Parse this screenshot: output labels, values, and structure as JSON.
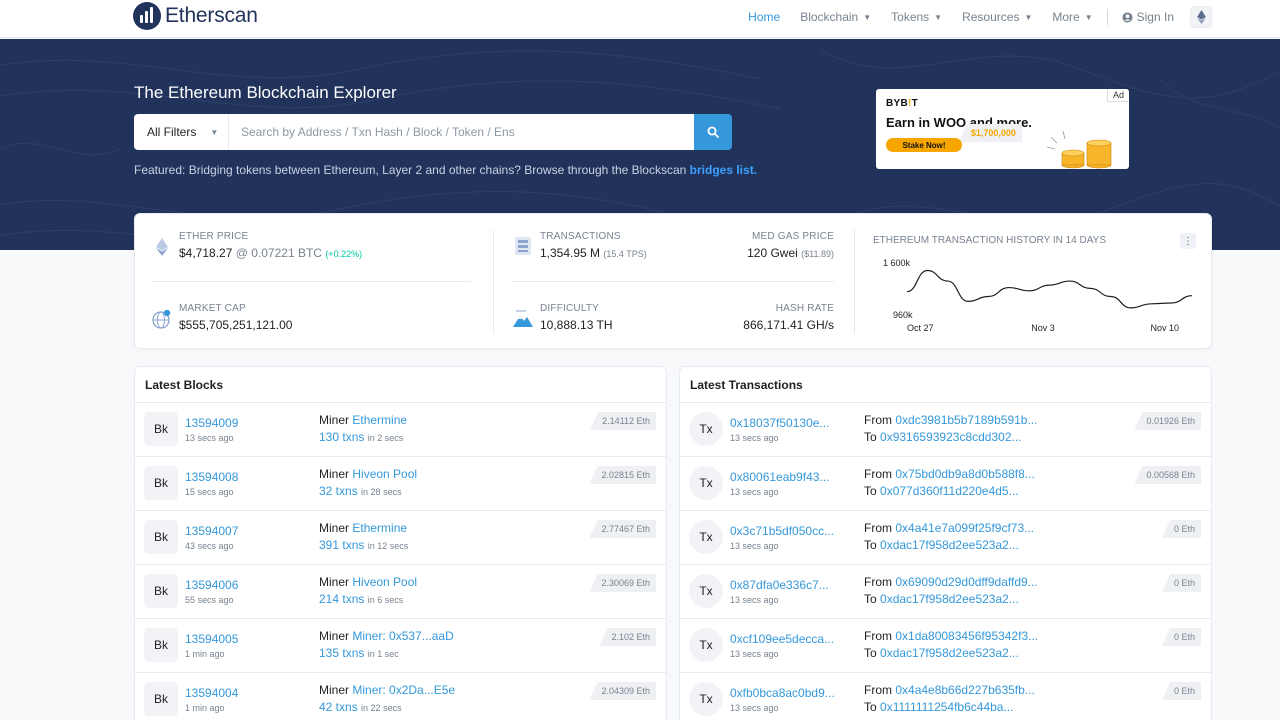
{
  "nav": {
    "logo_text": "Etherscan",
    "links": [
      {
        "label": "Home",
        "dropdown": false,
        "active": true
      },
      {
        "label": "Blockchain",
        "dropdown": true,
        "active": false
      },
      {
        "label": "Tokens",
        "dropdown": true,
        "active": false
      },
      {
        "label": "Resources",
        "dropdown": true,
        "active": false
      },
      {
        "label": "More",
        "dropdown": true,
        "active": false
      }
    ],
    "signin_label": "Sign In"
  },
  "hero": {
    "title": "The Ethereum Blockchain Explorer",
    "filter_label": "All Filters",
    "search_placeholder": "Search by Address / Txn Hash / Block / Token / Ens",
    "featured_text": "Featured: Bridging tokens between Ethereum, Layer 2 and other chains? Browse through the Blockscan ",
    "featured_link": "bridges list."
  },
  "ad": {
    "tag": "Ad",
    "brand_a": "BYB",
    "brand_b": "!",
    "brand_c": "T",
    "headline_a": "Earn ",
    "headline_amt": "$1,700,000",
    "headline_b": " in WOO and more.",
    "cta": "Stake Now!"
  },
  "stats": {
    "ether_price_label": "Ether Price",
    "ether_price_usd": "$4,718.27",
    "ether_price_btc": "@ 0.07221 BTC",
    "ether_price_change": "(+0.22%)",
    "market_cap_label": "Market Cap",
    "market_cap_value": "$555,705,251,121.00",
    "transactions_label": "Transactions",
    "transactions_value": "1,354.95 M",
    "transactions_tps": "(15.4 TPS)",
    "gas_label": "Med Gas Price",
    "gas_value": "120 Gwei",
    "gas_usd": "($11.89)",
    "difficulty_label": "Difficulty",
    "difficulty_value": "10,888.13 TH",
    "hashrate_label": "Hash Rate",
    "hashrate_value": "866,171.41 GH/s"
  },
  "chart_data": {
    "type": "line",
    "title": "Ethereum Transaction History in 14 Days",
    "x_ticks": [
      "Oct 27",
      "Nov 3",
      "Nov 10"
    ],
    "y_ticks": [
      "1 600k",
      "960k"
    ],
    "x": [
      "Oct 27",
      "Oct 28",
      "Oct 29",
      "Oct 30",
      "Oct 31",
      "Nov 1",
      "Nov 2",
      "Nov 3",
      "Nov 4",
      "Nov 5",
      "Nov 6",
      "Nov 7",
      "Nov 8",
      "Nov 9",
      "Nov 10"
    ],
    "values": [
      1260000,
      1520000,
      1390000,
      1140000,
      1200000,
      1310000,
      1270000,
      1340000,
      1390000,
      1300000,
      1200000,
      1060000,
      1110000,
      1120000,
      1210000
    ],
    "ylim": [
      960000,
      1600000
    ]
  },
  "latest_blocks": {
    "title": "Latest Blocks",
    "badge": "Bk",
    "miner_prefix": "Miner",
    "rows": [
      {
        "block": "13594009",
        "age": "13 secs ago",
        "miner": "Ethermine",
        "txns": "130 txns",
        "txn_time": "in 2 secs",
        "reward": "2.14112 Eth"
      },
      {
        "block": "13594008",
        "age": "15 secs ago",
        "miner": "Hiveon Pool",
        "txns": "32 txns",
        "txn_time": "in 28 secs",
        "reward": "2.02815 Eth"
      },
      {
        "block": "13594007",
        "age": "43 secs ago",
        "miner": "Ethermine",
        "txns": "391 txns",
        "txn_time": "in 12 secs",
        "reward": "2.77467 Eth"
      },
      {
        "block": "13594006",
        "age": "55 secs ago",
        "miner": "Hiveon Pool",
        "txns": "214 txns",
        "txn_time": "in 6 secs",
        "reward": "2.30069 Eth"
      },
      {
        "block": "13594005",
        "age": "1 min ago",
        "miner": "Miner: 0x537...aaD",
        "txns": "135 txns",
        "txn_time": "in 1 sec",
        "reward": "2.102 Eth"
      },
      {
        "block": "13594004",
        "age": "1 min ago",
        "miner": "Miner: 0x2Da...E5e",
        "txns": "42 txns",
        "txn_time": "in 22 secs",
        "reward": "2.04309 Eth"
      }
    ]
  },
  "latest_transactions": {
    "title": "Latest Transactions",
    "badge": "Tx",
    "from_prefix": "From",
    "to_prefix": "To",
    "rows": [
      {
        "hash": "0x18037f50130e...",
        "age": "13 secs ago",
        "from": "0xdc3981b5b7189b591b...",
        "to": "0x9316593923c8cdd302...",
        "value": "0.01926 Eth"
      },
      {
        "hash": "0x80061eab9f43...",
        "age": "13 secs ago",
        "from": "0x75bd0db9a8d0b588f8...",
        "to": "0x077d360f11d220e4d5...",
        "value": "0.00568 Eth"
      },
      {
        "hash": "0x3c71b5df050cc...",
        "age": "13 secs ago",
        "from": "0x4a41e7a099f25f9cf73...",
        "to": "0xdac17f958d2ee523a2...",
        "value": "0 Eth"
      },
      {
        "hash": "0x87dfa0e336c7...",
        "age": "13 secs ago",
        "from": "0x69090d29d0dff9daffd9...",
        "to": "0xdac17f958d2ee523a2...",
        "value": "0 Eth"
      },
      {
        "hash": "0xcf109ee5decca...",
        "age": "13 secs ago",
        "from": "0x1da80083456f95342f3...",
        "to": "0xdac17f958d2ee523a2...",
        "value": "0 Eth"
      },
      {
        "hash": "0xfb0bca8ac0bd9...",
        "age": "13 secs ago",
        "from": "0x4a4e8b66d227b635fb...",
        "to": "0x1111111254fb6c44ba...",
        "value": "0 Eth"
      }
    ]
  },
  "colors": {
    "brand_navy": "#21325b",
    "link_blue": "#3498db",
    "positive_green": "#00c9a7",
    "ad_orange": "#f7a600"
  }
}
